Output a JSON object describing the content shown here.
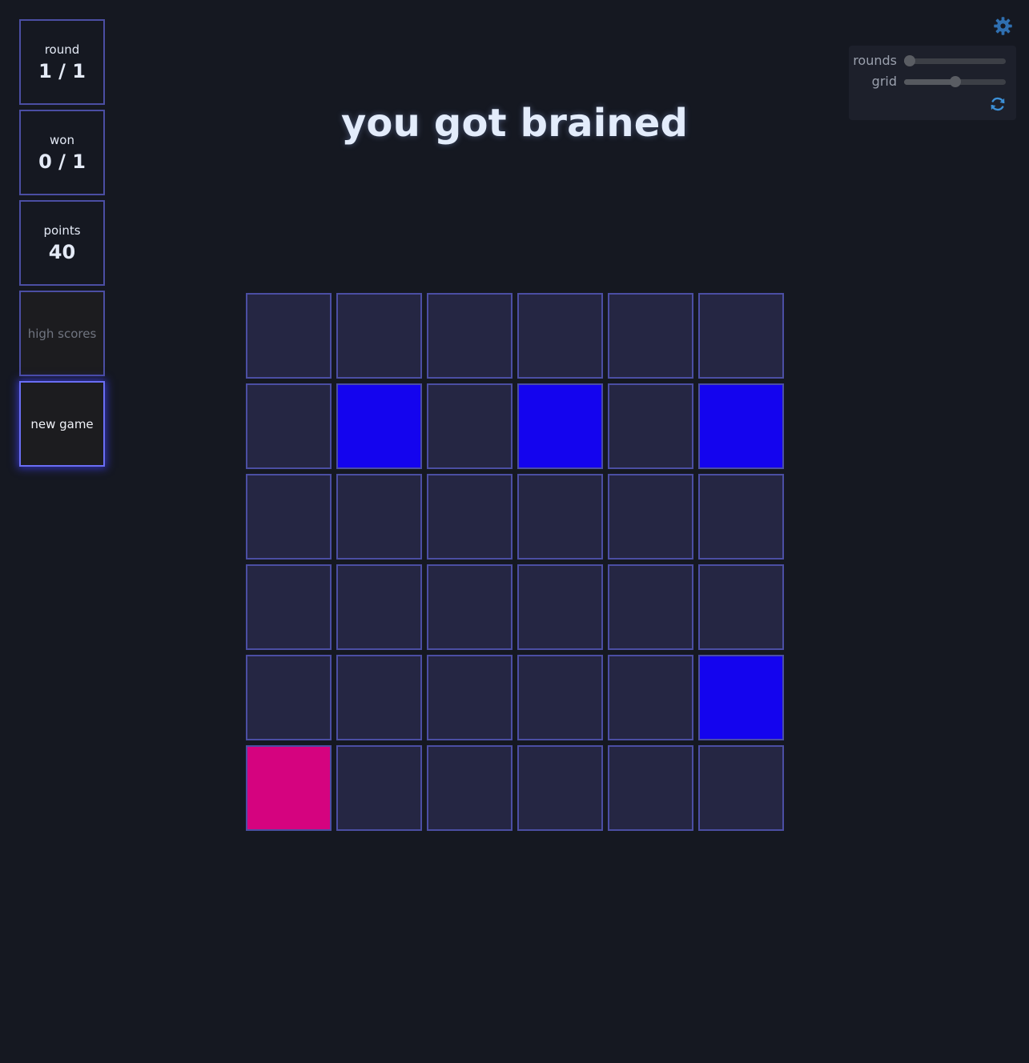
{
  "stats": {
    "round": {
      "label": "round",
      "value": "1 / 1"
    },
    "won": {
      "label": "won",
      "value": "0 / 1"
    },
    "points": {
      "label": "points",
      "value": "40"
    },
    "high_scores_label": "high scores",
    "new_game_label": "new game"
  },
  "title": "you got brained",
  "settings": {
    "rounds": {
      "label": "rounds",
      "level": 0.0
    },
    "grid": {
      "label": "grid",
      "level": 0.5
    },
    "icon": "gear-icon",
    "refresh_icon": "refresh-icon"
  },
  "colors": {
    "background": "#151821",
    "cell_empty": "#252643",
    "cell_border": "#4b4ea3",
    "cell_correct": "#1404ee",
    "cell_wrong": "#d5037f",
    "accent": "#2f6fb0"
  },
  "board": {
    "size": 6,
    "cells": [
      [
        "empty",
        "empty",
        "empty",
        "empty",
        "empty",
        "empty"
      ],
      [
        "empty",
        "correct",
        "empty",
        "correct",
        "empty",
        "correct"
      ],
      [
        "empty",
        "empty",
        "empty",
        "empty",
        "empty",
        "empty"
      ],
      [
        "empty",
        "empty",
        "empty",
        "empty",
        "empty",
        "empty"
      ],
      [
        "empty",
        "empty",
        "empty",
        "empty",
        "empty",
        "correct"
      ],
      [
        "wrong",
        "empty",
        "empty",
        "empty",
        "empty",
        "empty"
      ]
    ]
  }
}
